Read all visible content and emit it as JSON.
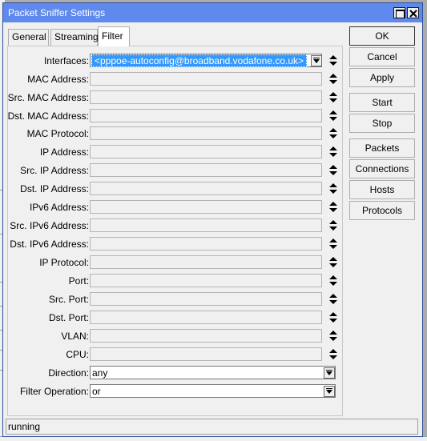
{
  "window": {
    "title": "Packet Sniffer Settings"
  },
  "tabs": [
    {
      "label": "General",
      "active": false
    },
    {
      "label": "Streaming",
      "active": false
    },
    {
      "label": "Filter",
      "active": true
    }
  ],
  "filter": {
    "interfaces": {
      "label": "Interfaces:",
      "value": "<pppoe-autoconfig@broadband.vodafone.co.uk>"
    },
    "mac_address": {
      "label": "MAC Address:",
      "value": ""
    },
    "src_mac_address": {
      "label": "Src. MAC Address:",
      "value": ""
    },
    "dst_mac_address": {
      "label": "Dst. MAC Address:",
      "value": ""
    },
    "mac_protocol": {
      "label": "MAC Protocol:",
      "value": ""
    },
    "ip_address": {
      "label": "IP Address:",
      "value": ""
    },
    "src_ip_address": {
      "label": "Src. IP Address:",
      "value": ""
    },
    "dst_ip_address": {
      "label": "Dst. IP Address:",
      "value": ""
    },
    "ipv6_address": {
      "label": "IPv6 Address:",
      "value": ""
    },
    "src_ipv6_address": {
      "label": "Src. IPv6 Address:",
      "value": ""
    },
    "dst_ipv6_address": {
      "label": "Dst. IPv6 Address:",
      "value": ""
    },
    "ip_protocol": {
      "label": "IP Protocol:",
      "value": ""
    },
    "port": {
      "label": "Port:",
      "value": ""
    },
    "src_port": {
      "label": "Src. Port:",
      "value": ""
    },
    "dst_port": {
      "label": "Dst. Port:",
      "value": ""
    },
    "vlan": {
      "label": "VLAN:",
      "value": ""
    },
    "cpu": {
      "label": "CPU:",
      "value": ""
    },
    "direction": {
      "label": "Direction:",
      "value": "any"
    },
    "filter_operation": {
      "label": "Filter Operation:",
      "value": "or"
    }
  },
  "buttons": {
    "ok": "OK",
    "cancel": "Cancel",
    "apply": "Apply",
    "start": "Start",
    "stop": "Stop",
    "packets": "Packets",
    "connections": "Connections",
    "hosts": "Hosts",
    "protocols": "Protocols"
  },
  "status": {
    "text": "running"
  },
  "colors": {
    "titlebar": "#5f89ec",
    "selection": "#3399ff",
    "background": "#f0f0f0"
  }
}
